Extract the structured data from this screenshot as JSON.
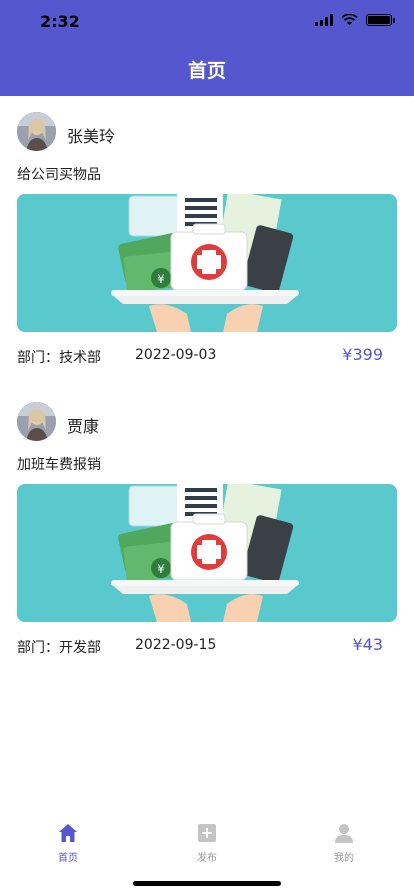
{
  "status": {
    "time": "2:32"
  },
  "header": {
    "title": "首页"
  },
  "posts": [
    {
      "user": "张美玲",
      "title": "给公司买物品",
      "department": "部门：技术部",
      "date": "2022-09-03",
      "amount": "¥399"
    },
    {
      "user": "贾康",
      "title": "加班车费报销",
      "department": "部门：开发部",
      "date": "2022-09-15",
      "amount": "¥43"
    }
  ],
  "tabs": [
    {
      "label": "首页",
      "icon": "home-icon",
      "active": true
    },
    {
      "label": "发布",
      "icon": "plus-square-icon",
      "active": false
    },
    {
      "label": "我的",
      "icon": "user-icon",
      "active": false
    }
  ],
  "colors": {
    "accent": "#5557cf",
    "banner_bg": "#5ac9cd",
    "inactive": "#999999"
  }
}
